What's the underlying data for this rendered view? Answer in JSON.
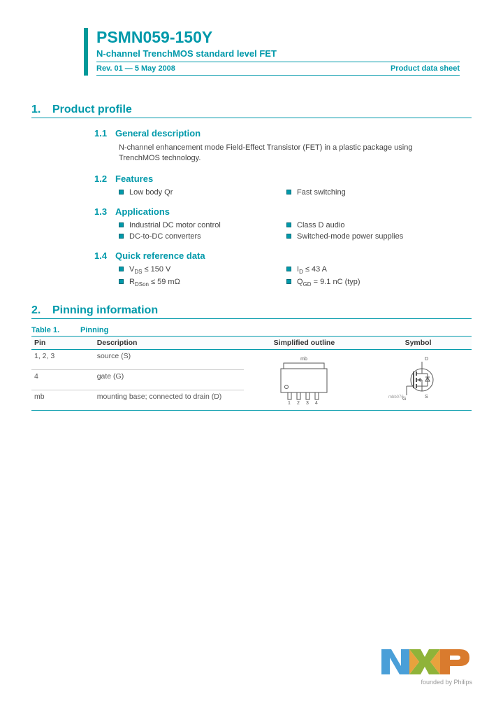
{
  "header": {
    "title": "PSMN059-150Y",
    "subtitle": "N-channel TrenchMOS standard level FET",
    "revision": "Rev. 01 — 5 May 2008",
    "doc_type": "Product data sheet"
  },
  "sections": {
    "s1": {
      "num": "1.",
      "title": "Product profile"
    },
    "s1_1": {
      "num": "1.1",
      "title": "General description",
      "body": "N-channel enhancement mode Field-Effect Transistor (FET) in a plastic package using TrenchMOS technology."
    },
    "s1_2": {
      "num": "1.2",
      "title": "Features",
      "left": [
        "Low body Qr"
      ],
      "right": [
        "Fast switching"
      ]
    },
    "s1_3": {
      "num": "1.3",
      "title": "Applications",
      "left": [
        "Industrial DC motor control",
        "DC-to-DC converters"
      ],
      "right": [
        "Class D audio",
        "Switched-mode power supplies"
      ]
    },
    "s1_4": {
      "num": "1.4",
      "title": "Quick reference data",
      "left": [
        "VDS ≤ 150 V",
        "RDSon ≤ 59 mΩ"
      ],
      "right": [
        "ID ≤ 43 A",
        "QGD = 9.1 nC (typ)"
      ]
    },
    "s2": {
      "num": "2.",
      "title": "Pinning information"
    }
  },
  "table1": {
    "caption_num": "Table 1.",
    "caption": "Pinning",
    "headers": [
      "Pin",
      "Description",
      "Simplified outline",
      "Symbol"
    ],
    "rows": [
      {
        "pin": "1, 2, 3",
        "desc": "source (S)"
      },
      {
        "pin": "4",
        "desc": "gate (G)"
      },
      {
        "pin": "mb",
        "desc": "mounting base; connected to drain (D)"
      }
    ],
    "outline_labels": {
      "top": "mb",
      "pins": [
        "1",
        "2",
        "3",
        "4"
      ]
    },
    "symbol_labels": {
      "d": "D",
      "g": "G",
      "s": "S",
      "ref": "mbb076"
    }
  },
  "logo": {
    "tagline": "founded by Philips"
  }
}
